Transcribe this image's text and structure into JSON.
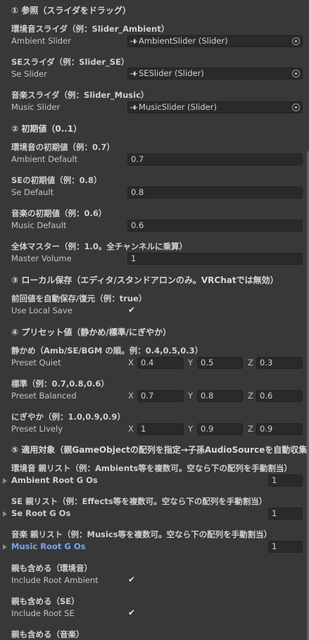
{
  "section1": "① 参照（スライダをドラッグ）",
  "ambient_slider": {
    "header": "環境音スライダ（例：Slider_Ambient）",
    "label": "Ambient Slider",
    "value": "AmbientSlider (Slider)"
  },
  "se_slider": {
    "header": "SEスライダ（例：Slider_SE）",
    "label": "Se Slider",
    "value": "SESlider (Slider)"
  },
  "music_slider": {
    "header": "音楽スライダ（例：Slider_Music）",
    "label": "Music Slider",
    "value": "MusicSlider (Slider)"
  },
  "section2": "② 初期値（0..1）",
  "ambient_default": {
    "header": "環境音の初期値（例：0.7）",
    "label": "Ambient Default",
    "value": "0.7"
  },
  "se_default": {
    "header": "SEの初期値（例：0.8）",
    "label": "Se Default",
    "value": "0.8"
  },
  "music_default": {
    "header": "音楽の初期値（例：0.6）",
    "label": "Music Default",
    "value": "0.6"
  },
  "master_volume": {
    "header": "全体マスター（例：1.0。全チャンネルに乗算）",
    "label": "Master Volume",
    "value": "1"
  },
  "section3": "③ ローカル保存（エディタ/スタンドアロンのみ。VRChatでは無効）",
  "use_local_save": {
    "header": "前回値を自動保存/復元（例：true）",
    "label": "Use Local Save",
    "checked": "✔"
  },
  "section4": "④ プリセット値（静かめ/標準/にぎやか）",
  "axis": {
    "x": "X",
    "y": "Y",
    "z": "Z"
  },
  "preset_quiet": {
    "header": "静かめ（Amb/SE/BGM の順。例：0.4,0.5,0.3）",
    "label": "Preset Quiet",
    "x": "0.4",
    "y": "0.5",
    "z": "0.3"
  },
  "preset_balanced": {
    "header": "標準（例：0.7,0.8,0.6）",
    "label": "Preset Balanced",
    "x": "0.7",
    "y": "0.8",
    "z": "0.6"
  },
  "preset_lively": {
    "header": "にぎやか（例：1.0,0.9,0.9）",
    "label": "Preset Lively",
    "x": "1",
    "y": "0.9",
    "z": "0.9"
  },
  "section5": "⑤ 適用対象（親GameObjectの配列を指定→子孫AudioSourceを自動収集）",
  "ambient_root": {
    "header": "環境音 親リスト（例：Ambients等を複数可。空なら下の配列を手動割当）",
    "label": "Ambient Root G Os",
    "count": "1"
  },
  "se_root": {
    "header": "SE 親リスト（例：Effects等を複数可。空なら下の配列を手動割当）",
    "label": "Se Root G Os",
    "count": "1"
  },
  "music_root": {
    "header": "音楽 親リスト（例：Musics等を複数可。空なら下の配列を手動割当）",
    "label": "Music Root G Os",
    "count": "1"
  },
  "include_root_ambient": {
    "header": "親も含める（環境音）",
    "label": "Include Root Ambient",
    "checked": "✔"
  },
  "include_root_se": {
    "header": "親も含める（SE）",
    "label": "Include Root SE",
    "checked": "✔"
  },
  "include_root_music": {
    "header": "親も含める（音楽）"
  },
  "colors": {
    "background": "#383838",
    "field": "#2a2a2a",
    "highlight": "#7aa6ee"
  }
}
